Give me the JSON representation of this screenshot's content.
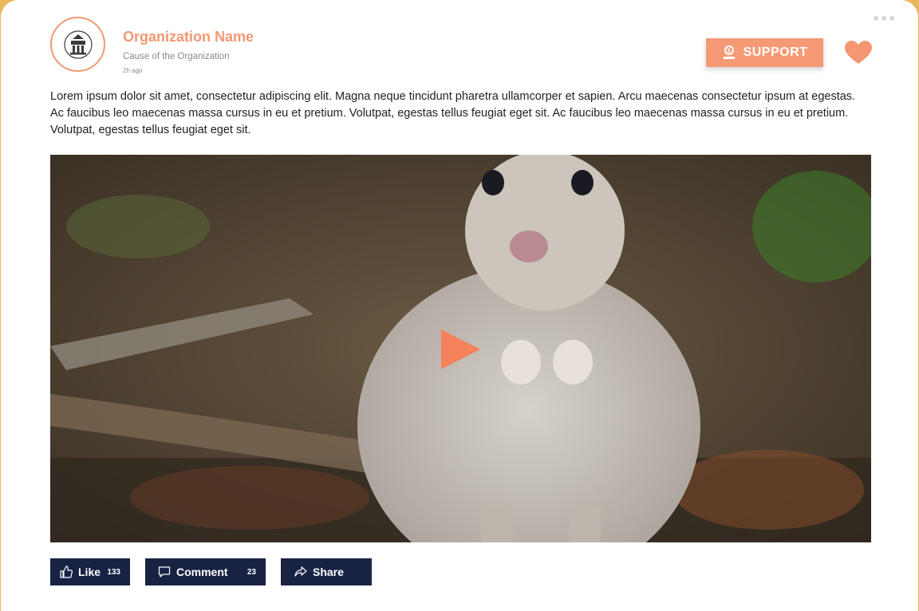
{
  "post": {
    "org_name": "Organization Name",
    "cause": "Cause of the Organization",
    "time": "2h ago",
    "text": "Lorem ipsum dolor sit amet, consectetur adipiscing elit. Magna neque tincidunt pharetra ullamcorper et sapien. Arcu maecenas consectetur ipsum at egestas. Ac faucibus leo maecenas massa cursus in eu et pretium. Volutpat, egestas tellus feugiat eget sit. Ac faucibus leo maecenas massa cursus in eu et pretium. Volutpat, egestas tellus feugiat eget sit."
  },
  "support": {
    "label": "SUPPORT",
    "icon": "donate-icon"
  },
  "media": {
    "type": "video",
    "play_icon": "play-icon"
  },
  "actions": {
    "like": {
      "label": "Like",
      "count": "133",
      "icon": "thumbs-up-icon"
    },
    "comment": {
      "label": "Comment",
      "count": "23",
      "icon": "comment-icon"
    },
    "share": {
      "label": "Share",
      "icon": "share-icon"
    }
  },
  "colors": {
    "accent": "#f39872",
    "button_dark": "#182344",
    "frame": "#e9b85a"
  }
}
